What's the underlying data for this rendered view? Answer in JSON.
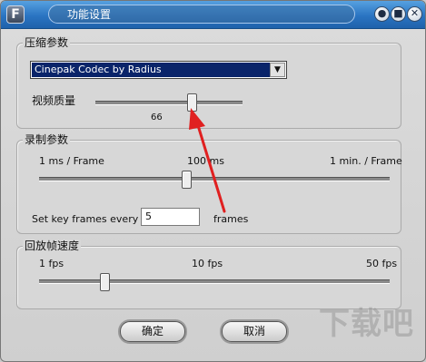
{
  "window": {
    "title": "功能设置"
  },
  "title_buttons": [
    {
      "name": "minimize",
      "glyph": "●"
    },
    {
      "name": "maximize",
      "glyph": "■"
    },
    {
      "name": "close",
      "glyph": "✕"
    }
  ],
  "compression": {
    "group_title": "压缩参数",
    "codec_value": "Cinepak Codec by Radius",
    "dropdown_glyph": "▼",
    "quality_label": "视频质量",
    "quality_value": "66"
  },
  "recording": {
    "group_title": "录制参数",
    "scale_min": "1 ms / Frame",
    "scale_mid": "100 ms",
    "scale_max": "1 min. / Frame",
    "keyframe_label": "Set key frames every",
    "keyframe_value": "5",
    "keyframe_unit": "frames"
  },
  "playback": {
    "group_title": "回放帧速度",
    "scale_min": "1 fps",
    "scale_mid": "10 fps",
    "scale_max": "50 fps"
  },
  "buttons": {
    "ok": "确定",
    "cancel": "取消"
  },
  "watermark": {
    "text": "下载吧"
  },
  "annotation": {
    "arrow_color": "#e02020"
  },
  "colors": {
    "titlebar": "#2a74c2",
    "selection": "#0a246a"
  }
}
